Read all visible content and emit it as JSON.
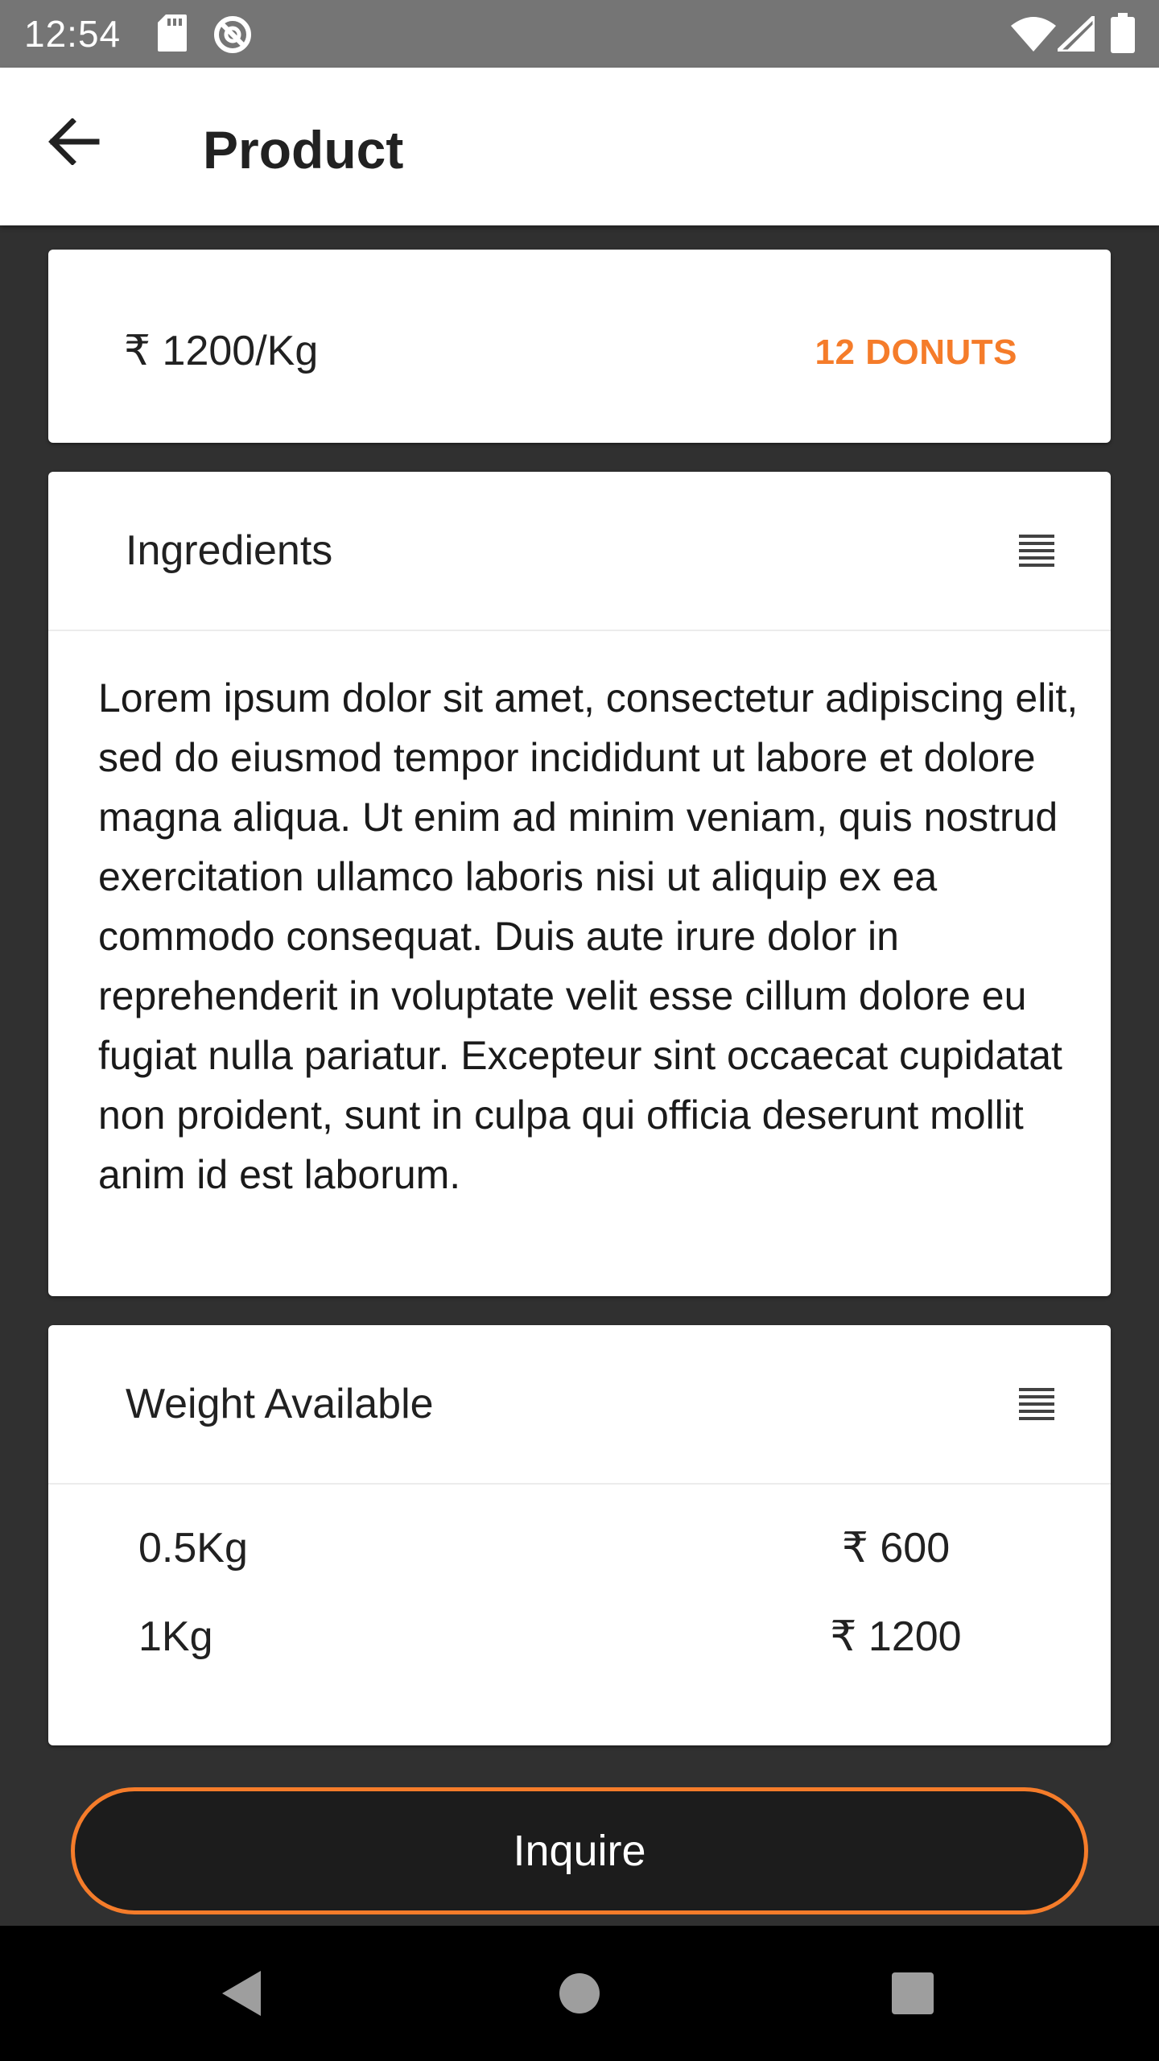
{
  "status_bar": {
    "time": "12:54",
    "icons": [
      "sd-card-icon",
      "no-data-icon",
      "wifi-icon",
      "cell-signal-icon",
      "battery-icon"
    ]
  },
  "app_bar": {
    "title": "Product",
    "back_icon": "arrow-back-icon"
  },
  "price_card": {
    "price": "₹ 1200/Kg",
    "count_label": "12 DONUTS",
    "accent_color": "#F57C2A"
  },
  "ingredients": {
    "title": "Ingredients",
    "icon": "list-icon",
    "body": "Lorem ipsum dolor sit amet, consectetur adipiscing elit, sed do eiusmod tempor incididunt ut labore et dolore magna aliqua. Ut enim ad minim veniam, quis nostrud exercitation ullamco laboris nisi ut aliquip ex ea commodo consequat. Duis aute irure dolor in reprehenderit in voluptate velit esse cillum dolore eu fugiat nulla pariatur. Excepteur sint occaecat cupidatat non proident, sunt in culpa qui officia deserunt mollit anim id est laborum."
  },
  "weights": {
    "title": "Weight Available",
    "icon": "list-icon",
    "rows": [
      {
        "weight": "0.5Kg",
        "price": "₹ 600"
      },
      {
        "weight": "1Kg",
        "price": "₹ 1200"
      }
    ]
  },
  "inquire": {
    "label": "Inquire",
    "border_color": "#F57C2A"
  },
  "nav_bar": {
    "icons": [
      "nav-back-icon",
      "nav-home-icon",
      "nav-recents-icon"
    ]
  }
}
